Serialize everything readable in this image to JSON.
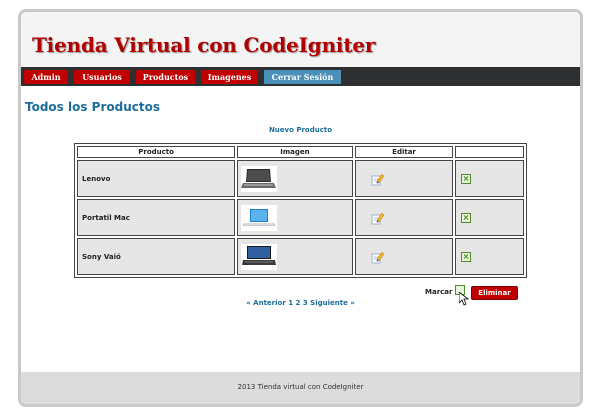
{
  "header": {
    "title": "Tienda Virtual con CodeIgniter"
  },
  "nav": {
    "items": [
      {
        "label": "Admin"
      },
      {
        "label": "Usuarios"
      },
      {
        "label": "Productos"
      },
      {
        "label": "Imagenes"
      },
      {
        "label": "Cerrar Sesión"
      }
    ],
    "colors": {
      "red": "#c00000",
      "blue": "#4a90b8",
      "bar": "#2d2f31"
    }
  },
  "main": {
    "page_title": "Todos los Productos",
    "new_product_link": "Nuevo Producto",
    "table": {
      "headers": [
        "Producto",
        "Imagen",
        "Editar",
        ""
      ],
      "rows": [
        {
          "name": "Lenovo",
          "image_icon": "laptop-thumbnail",
          "edit_icon": "pencil-edit-icon",
          "check_icon": "checkbox-icon"
        },
        {
          "name": "Portatil Mac",
          "image_icon": "laptop-thumbnail",
          "edit_icon": "pencil-edit-icon",
          "check_icon": "checkbox-icon"
        },
        {
          "name": "Sony Vaió",
          "image_icon": "laptop-thumbnail",
          "edit_icon": "pencil-edit-icon",
          "check_icon": "checkbox-icon"
        }
      ]
    },
    "actions": {
      "mark_label": "Marcar",
      "delete_label": "Eliminar"
    },
    "pagination": {
      "prev": "« Anterior",
      "pages": [
        "1",
        "2",
        "3"
      ],
      "next": "Siguiente »"
    }
  },
  "footer": {
    "text": "2013 Tienda virtual con CodeIgniter"
  }
}
